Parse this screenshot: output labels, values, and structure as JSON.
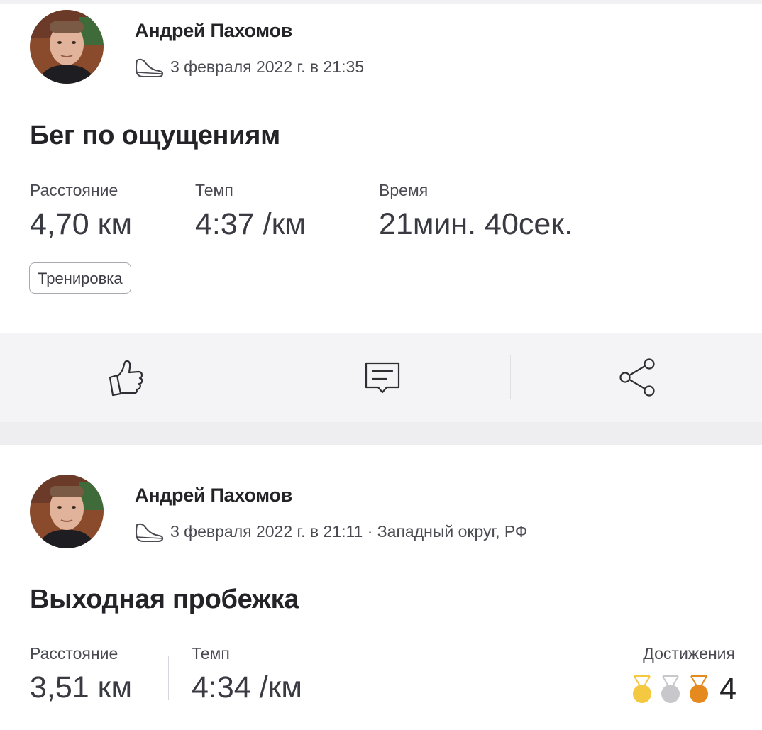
{
  "posts": [
    {
      "author": "Андрей Пахомов",
      "meta": "3 февраля 2022 г. в 21:35",
      "title": "Бег по ощущениям",
      "stats": [
        {
          "label": "Расстояние",
          "value": "4,70 км"
        },
        {
          "label": "Темп",
          "value": "4:37 /км"
        },
        {
          "label": "Время",
          "value": "21мин. 40сек."
        }
      ],
      "tag": "Тренировка",
      "actions": {
        "like_icon": "thumbs-up-icon",
        "comment_icon": "comment-icon",
        "share_icon": "share-icon"
      }
    },
    {
      "author": "Андрей Пахомов",
      "meta": "3 февраля 2022 г. в 21:11 · Западный округ, РФ",
      "title": "Выходная пробежка",
      "stats": [
        {
          "label": "Расстояние",
          "value": "3,51 км"
        },
        {
          "label": "Темп",
          "value": "4:34 /км"
        }
      ],
      "achievements": {
        "label": "Достижения",
        "count": "4",
        "medals": [
          {
            "kind": "gold",
            "color": "#f5c842"
          },
          {
            "kind": "silver",
            "color": "#c8c8cc"
          },
          {
            "kind": "bronze",
            "color": "#e58a1f"
          }
        ]
      }
    }
  ],
  "colors": {
    "text": "#242428",
    "muted": "#4a4a52",
    "action_bar": "#f4f4f6"
  }
}
